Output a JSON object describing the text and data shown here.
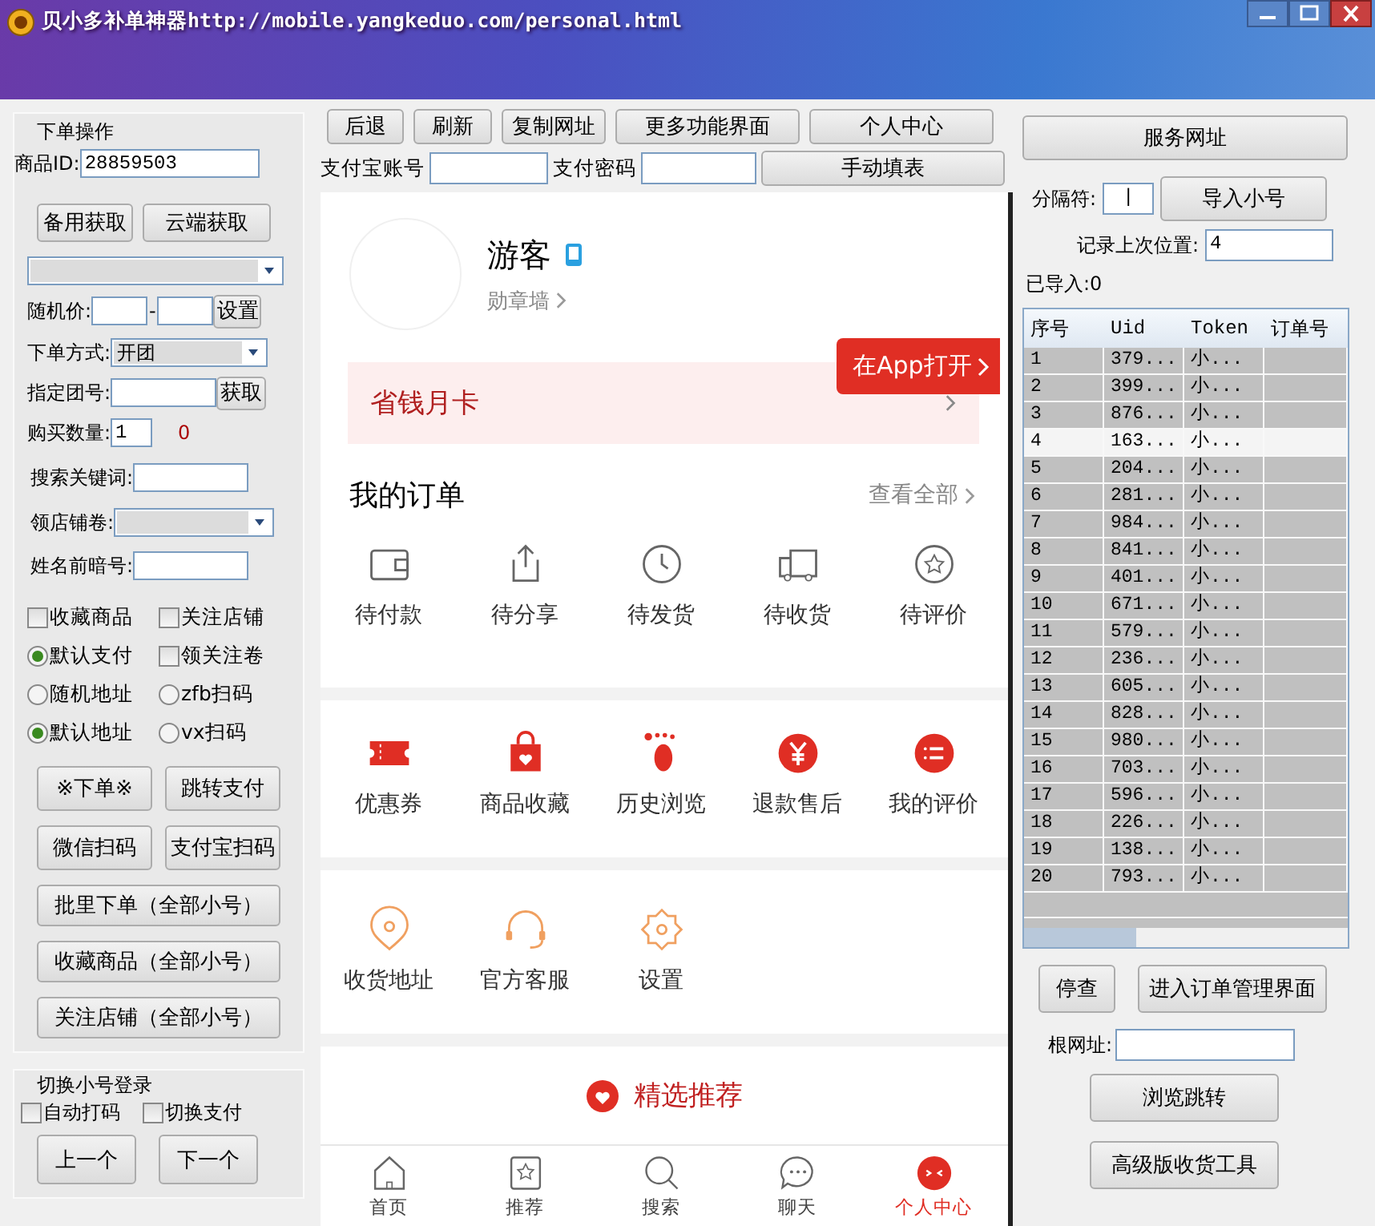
{
  "window": {
    "title": "贝小多补单神器http://mobile.yangkeduo.com/personal.html"
  },
  "left_panel": {
    "group_title": "下单操作",
    "product_id": {
      "label": "商品ID:",
      "value": "28859503"
    },
    "fetch_buttons": [
      "备用获取",
      "云端获取"
    ],
    "random_price": {
      "label": "随机价:",
      "separator": "-",
      "button": "设置"
    },
    "order_mode": {
      "label": "下单方式:",
      "value": "开团"
    },
    "group_no": {
      "label": "指定团号:",
      "button": "获取"
    },
    "quantity": {
      "label": "购买数量:",
      "value": "1",
      "count": "0"
    },
    "keyword": {
      "label": "搜索关键词:"
    },
    "coupon": {
      "label": "领店铺卷:"
    },
    "name_code": {
      "label": "姓名前暗号:"
    },
    "options": [
      {
        "kind": "checkbox",
        "label": "收藏商品",
        "checked": false
      },
      {
        "kind": "checkbox",
        "label": "关注店铺",
        "checked": false
      },
      {
        "kind": "radio",
        "label": "默认支付",
        "selected": true
      },
      {
        "kind": "checkbox",
        "label": "领关注卷",
        "checked": false
      },
      {
        "kind": "radio",
        "label": "随机地址",
        "selected": false
      },
      {
        "kind": "radio",
        "label": "zfb扫码",
        "selected": false
      },
      {
        "kind": "radio",
        "label": "默认地址",
        "selected": true
      },
      {
        "kind": "radio",
        "label": "vx扫码",
        "selected": false
      }
    ],
    "action_buttons": [
      [
        "※下单※",
        "跳转支付"
      ],
      [
        "微信扫码",
        "支付宝扫码"
      ],
      [
        "批里下单（全部小号）"
      ],
      [
        "收藏商品（全部小号）"
      ],
      [
        "关注店铺（全部小号）"
      ]
    ],
    "switch_group": {
      "title": "切换小号登录",
      "options": [
        {
          "label": "自动打码",
          "checked": false
        },
        {
          "label": "切换支付",
          "checked": false
        }
      ],
      "buttons": [
        "上一个",
        "下一个"
      ]
    }
  },
  "browser": {
    "toolbar": [
      "后退",
      "刷新",
      "复制网址",
      "更多功能界面",
      "个人中心"
    ],
    "alipay_account_label": "支付宝账号",
    "alipay_password_label": "支付密码",
    "fill_button": "手动填表",
    "page": {
      "user_name": "游客",
      "badge_link": "勋章墙",
      "open_in_app": "在App打开",
      "banner": "省钱月卡",
      "orders_title": "我的订单",
      "view_all": "查看全部",
      "order_items": [
        "待付款",
        "待分享",
        "待发货",
        "待收货",
        "待评价"
      ],
      "service_items": [
        "优惠券",
        "商品收藏",
        "历史浏览",
        "退款售后",
        "我的评价"
      ],
      "tool_items": [
        "收货地址",
        "官方客服",
        "设置"
      ],
      "recommend": "精选推荐",
      "nav": [
        {
          "label": "首页",
          "selected": false
        },
        {
          "label": "推荐",
          "selected": false
        },
        {
          "label": "搜索",
          "selected": false
        },
        {
          "label": "聊天",
          "selected": false
        },
        {
          "label": "个人中心",
          "selected": true
        }
      ]
    }
  },
  "right_panel": {
    "service_button": "服务网址",
    "separator": {
      "label": "分隔符:",
      "value": "|"
    },
    "import_button": "导入小号",
    "last_position": {
      "label": "记录上次位置:",
      "value": "4"
    },
    "imported": "已导入:0",
    "table": {
      "columns": [
        "序号",
        "Uid",
        "Token",
        "订单号"
      ],
      "rows": [
        {
          "cells": [
            "1",
            "379...",
            "小..."
          ],
          "selected": false
        },
        {
          "cells": [
            "2",
            "399...",
            "小..."
          ],
          "selected": false
        },
        {
          "cells": [
            "3",
            "876...",
            "小..."
          ],
          "selected": false
        },
        {
          "cells": [
            "4",
            "163...",
            "小..."
          ],
          "selected": true
        },
        {
          "cells": [
            "5",
            "204...",
            "小..."
          ],
          "selected": false
        },
        {
          "cells": [
            "6",
            "281...",
            "小..."
          ],
          "selected": false
        },
        {
          "cells": [
            "7",
            "984...",
            "小..."
          ],
          "selected": false
        },
        {
          "cells": [
            "8",
            "841...",
            "小..."
          ],
          "selected": false
        },
        {
          "cells": [
            "9",
            "401...",
            "小..."
          ],
          "selected": false
        },
        {
          "cells": [
            "10",
            "671...",
            "小..."
          ],
          "selected": false
        },
        {
          "cells": [
            "11",
            "579...",
            "小..."
          ],
          "selected": false
        },
        {
          "cells": [
            "12",
            "236...",
            "小..."
          ],
          "selected": false
        },
        {
          "cells": [
            "13",
            "605...",
            "小..."
          ],
          "selected": false
        },
        {
          "cells": [
            "14",
            "828...",
            "小..."
          ],
          "selected": false
        },
        {
          "cells": [
            "15",
            "980...",
            "小..."
          ],
          "selected": false
        },
        {
          "cells": [
            "16",
            "703...",
            "小..."
          ],
          "selected": false
        },
        {
          "cells": [
            "17",
            "596...",
            "小..."
          ],
          "selected": false
        },
        {
          "cells": [
            "18",
            "226...",
            "小..."
          ],
          "selected": false
        },
        {
          "cells": [
            "19",
            "138...",
            "小..."
          ],
          "selected": false
        },
        {
          "cells": [
            "20",
            "793...",
            "小..."
          ],
          "selected": false
        }
      ]
    },
    "stop_button": "停查",
    "orders_button": "进入订单管理界面",
    "root_url": {
      "label": "根网址:"
    },
    "browse_button": "浏览跳转",
    "advanced_button": "高级版收货工具"
  }
}
